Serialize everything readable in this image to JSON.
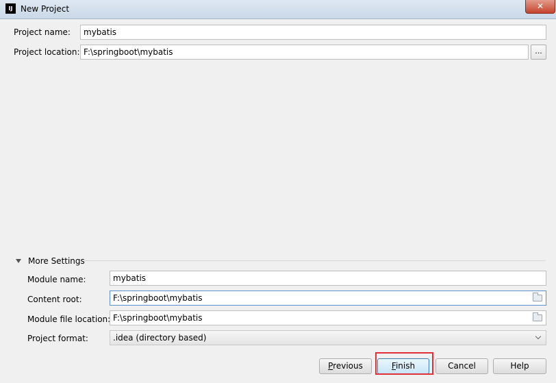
{
  "window": {
    "title": "New Project",
    "app_icon_label": "IJ",
    "close_label": "✕"
  },
  "form": {
    "project_name_label": "Project name:",
    "project_name_value": "mybatis",
    "project_location_label": "Project location:",
    "project_location_value": "F:\\springboot\\mybatis",
    "browse_label": "..."
  },
  "more_settings": {
    "title": "More Settings",
    "module_name_label": "Module name:",
    "module_name_value": "mybatis",
    "content_root_label": "Content root:",
    "content_root_value": "F:\\springboot\\mybatis",
    "module_file_location_label": "Module file location:",
    "module_file_location_value": "F:\\springboot\\mybatis",
    "project_format_label": "Project format:",
    "project_format_value": ".idea (directory based)"
  },
  "buttons": {
    "previous_first": "P",
    "previous_rest": "revious",
    "finish_first": "F",
    "finish_rest": "inish",
    "cancel": "Cancel",
    "help": "Help"
  }
}
